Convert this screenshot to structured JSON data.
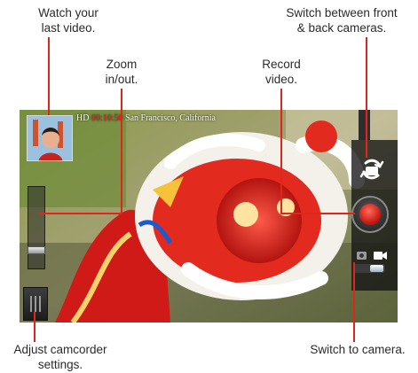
{
  "callouts": {
    "last_video": [
      "Watch your",
      "last video."
    ],
    "switch_cameras": [
      "Switch between front",
      "& back cameras."
    ],
    "zoom": [
      "Zoom",
      "in/out."
    ],
    "record": [
      "Record",
      "video."
    ],
    "settings": [
      "Adjust camcorder",
      "settings."
    ],
    "switch_to_camera": [
      "Switch to camera."
    ]
  },
  "hud": {
    "quality": "HD",
    "timer": "00:10:50",
    "location": "San Francisco, California"
  },
  "zoom_level": 0.15,
  "mode": "video",
  "colors": {
    "leader": "#e0251b",
    "record": "#d8241a",
    "panel": "#141414"
  },
  "icons": {
    "thumbnail": "last-video-thumbnail",
    "switch": "switch-camera-icon",
    "record": "record-icon",
    "camera": "camera-icon",
    "video": "video-icon",
    "settings": "settings-icon"
  }
}
